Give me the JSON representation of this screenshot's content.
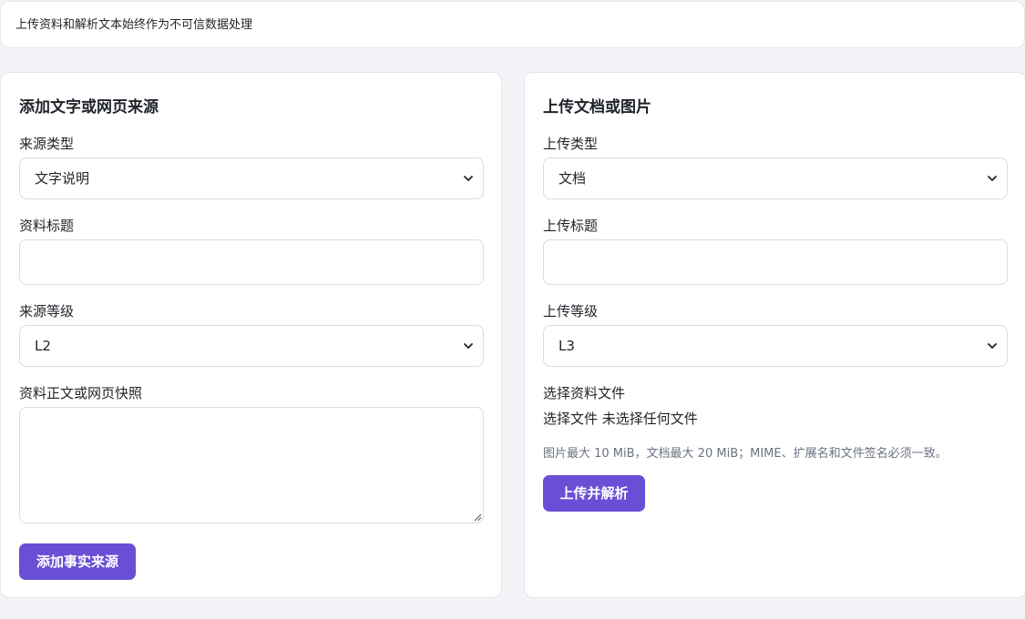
{
  "notice": {
    "text": "上传资料和解析文本始终作为不可信数据处理"
  },
  "text_source": {
    "title": "添加文字或网页来源",
    "type_label": "来源类型",
    "type_value": "文字说明",
    "title_label": "资料标题",
    "title_value": "",
    "level_label": "来源等级",
    "level_value": "L2",
    "body_label": "资料正文或网页快照",
    "body_value": "",
    "submit_label": "添加事实来源"
  },
  "upload": {
    "title": "上传文档或图片",
    "type_label": "上传类型",
    "type_value": "文档",
    "title_label": "上传标题",
    "title_value": "",
    "level_label": "上传等级",
    "level_value": "L3",
    "file_label": "选择资料文件",
    "file_button": "选择文件",
    "file_status": "未选择任何文件",
    "hint": "图片最大 10 MiB，文档最大 20 MiB；MIME、扩展名和文件签名必须一致。",
    "submit_label": "上传并解析"
  },
  "colors": {
    "accent": "#6a4fd6",
    "page_bg": "#f3f4f8",
    "border": "#e3e5ea"
  }
}
